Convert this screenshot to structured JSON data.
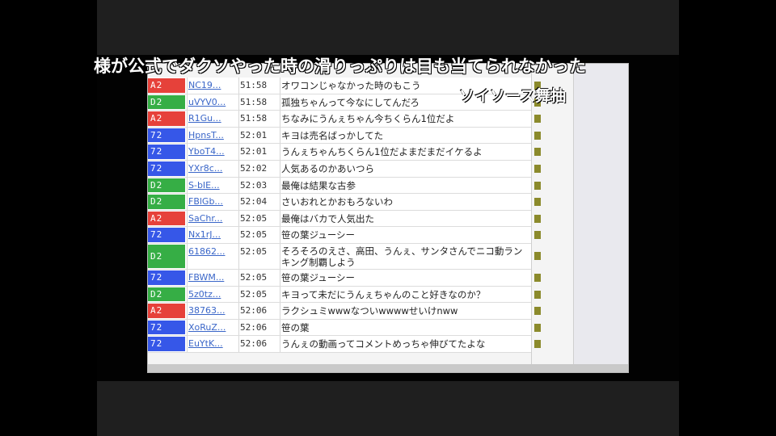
{
  "overlay_comments": [
    "様が公式でダクソやった時の滑りっぷりは目も当てられなかった",
    "ソイソース舞抽"
  ],
  "colors": {
    "red_badge": "#e6413a",
    "green_badge": "#36ae45",
    "blue_badge": "#3657e8",
    "user_link": "#3a66c8"
  },
  "rows": [
    {
      "badge": "A2",
      "color": "red",
      "user": "NC19...",
      "time": "51:58",
      "text": "オワコンじゃなかった時のもこう"
    },
    {
      "badge": "D2",
      "color": "green",
      "user": "uVYV0...",
      "time": "51:58",
      "text": "孤独ちゃんって今なにしてんだろ"
    },
    {
      "badge": "A2",
      "color": "red",
      "user": "R1Gu...",
      "time": "51:58",
      "text": "ちなみにうんぇちゃん今ちくらん1位だよ"
    },
    {
      "badge": "72",
      "color": "blue",
      "user": "HpnsT...",
      "time": "52:01",
      "text": "キヨは売名ばっかしてた"
    },
    {
      "badge": "72",
      "color": "blue",
      "user": "YboT4...",
      "time": "52:01",
      "text": "うんぇちゃんちくらん1位だよまだまだイケるよ"
    },
    {
      "badge": "72",
      "color": "blue",
      "user": "YXr8c...",
      "time": "52:02",
      "text": "人気あるのかあいつら"
    },
    {
      "badge": "D2",
      "color": "green",
      "user": "S-bIE...",
      "time": "52:03",
      "text": "最俺は結果な古参"
    },
    {
      "badge": "D2",
      "color": "green",
      "user": "FBlGb...",
      "time": "52:04",
      "text": "さいおれとかおもろないわ"
    },
    {
      "badge": "A2",
      "color": "red",
      "user": "SaChr...",
      "time": "52:05",
      "text": "最俺はバカで人気出た"
    },
    {
      "badge": "72",
      "color": "blue",
      "user": "Nx1rJ...",
      "time": "52:05",
      "text": "笹の葉ジューシー"
    },
    {
      "badge": "D2",
      "color": "green",
      "user": "61862...",
      "time": "52:05",
      "text": "そろそろのえさ、高田、うんぇ、サンタさんでニコ動ランキング制覇しよう",
      "tall": true
    },
    {
      "badge": "72",
      "color": "blue",
      "user": "FBWM...",
      "time": "52:05",
      "text": "笹の葉ジューシー"
    },
    {
      "badge": "D2",
      "color": "green",
      "user": "5z0tz...",
      "time": "52:05",
      "text": "キヨって未だにうんぇちゃんのこと好きなのか？"
    },
    {
      "badge": "A2",
      "color": "red",
      "user": "38763...",
      "time": "52:06",
      "text": "ラクシュミwwwなついwwwwせいけnww"
    },
    {
      "badge": "72",
      "color": "blue",
      "user": "XoRuZ...",
      "time": "52:06",
      "text": "笹の葉"
    },
    {
      "badge": "72",
      "color": "blue",
      "user": "EuYtK...",
      "time": "52:06",
      "text": "うんぇの動画ってコメントめっちゃ伸びてたよな"
    }
  ]
}
